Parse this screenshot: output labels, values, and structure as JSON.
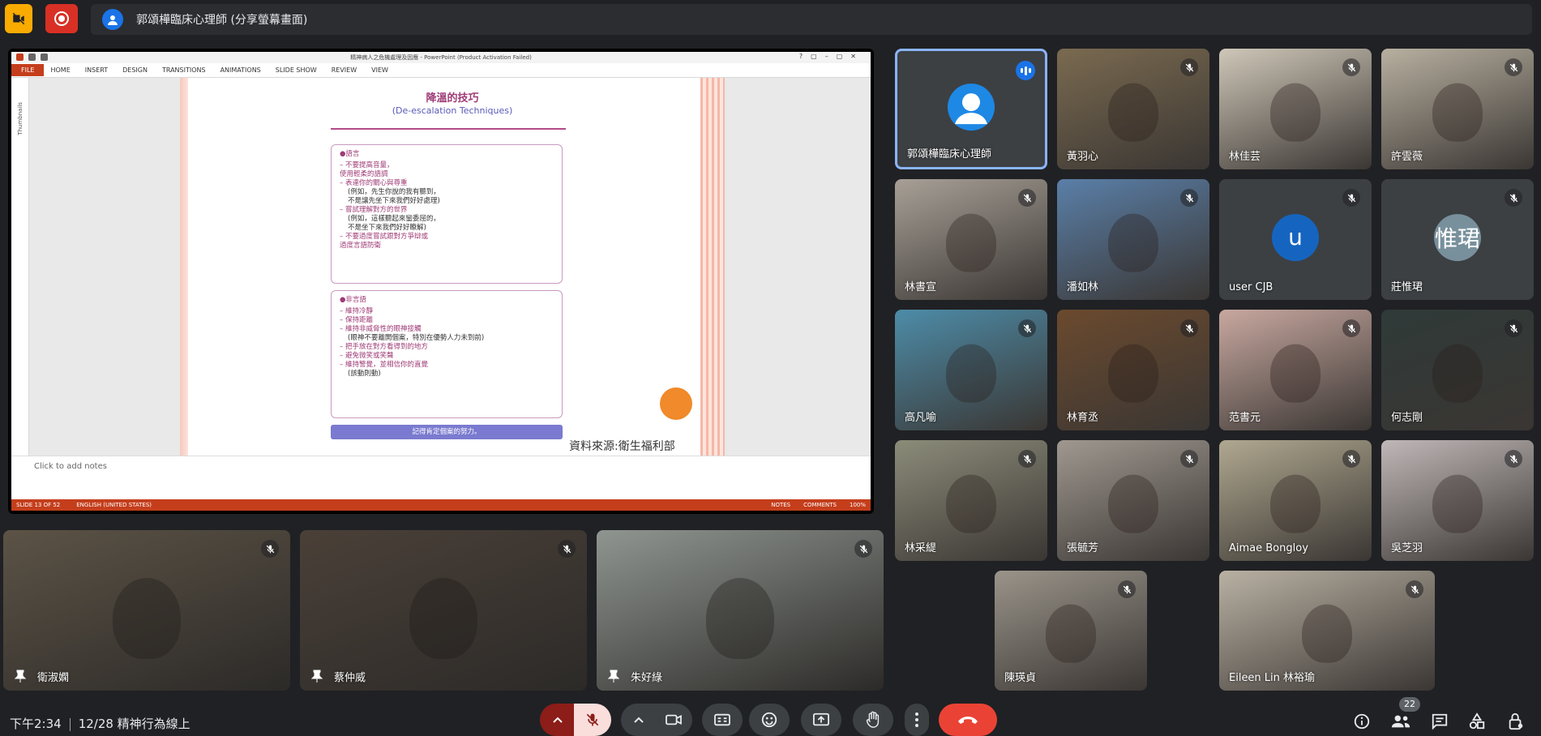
{
  "topbar": {
    "presenter_label": "郭頌樺臨床心理師 (分享螢幕畫面)"
  },
  "ppt": {
    "window_title": "精神病人之危機處理及因應 - PowerPoint (Product Activation Failed)",
    "menu": [
      "FILE",
      "HOME",
      "INSERT",
      "DESIGN",
      "TRANSITIONS",
      "ANIMATIONS",
      "SLIDE SHOW",
      "REVIEW",
      "VIEW"
    ],
    "thumbs_label": "Thumbnails",
    "slide_title": "降溫的技巧",
    "slide_subtitle": "(De-escalation Techniques)",
    "verbal_header": "●語言",
    "verbal_lines": [
      {
        "t": "ln",
        "v": "– 不要提高音量，"
      },
      {
        "t": "ln",
        "v": "   使用輕柔的語調"
      },
      {
        "t": "ln",
        "v": "– 表達你的關心與尊重"
      },
      {
        "t": "nt",
        "v": "(例如，先生你說的我有聽到，"
      },
      {
        "t": "nt",
        "v": "不是讓先坐下來我們好好處理)"
      },
      {
        "t": "ln",
        "v": "– 嘗試理解對方的世界"
      },
      {
        "t": "nt",
        "v": "(例如，這樣聽起來蠻委屈的，"
      },
      {
        "t": "nt",
        "v": "不是坐下來我們好好瞭解)"
      },
      {
        "t": "ln",
        "v": "– 不要過度嘗試跟對方爭辯或"
      },
      {
        "t": "ln",
        "v": "   過度言語防衛"
      }
    ],
    "nonverbal_header": "●非言語",
    "nonverbal_lines": [
      {
        "t": "ln",
        "v": "– 維持冷靜"
      },
      {
        "t": "ln",
        "v": "– 保持距離"
      },
      {
        "t": "ln",
        "v": "– 維持非威脅性的眼神接觸"
      },
      {
        "t": "nt",
        "v": "(眼神不要離開個案，特別在優勢人力未到前)"
      },
      {
        "t": "ln",
        "v": "– 把手放在對方看得到的地方"
      },
      {
        "t": "ln",
        "v": "– 避免微笑或笑聲"
      },
      {
        "t": "ln",
        "v": "– 維持警覺，並相信你的直覺"
      },
      {
        "t": "nt",
        "v": "(該動則動)"
      }
    ],
    "slide_bar": "記得肯定個案的努力。",
    "slide_source": "資料來源:衛生福利部",
    "notes_placeholder": "Click to add notes",
    "status_slide": "SLIDE 13 OF 52",
    "status_lang": "ENGLISH (UNITED STATES)",
    "status_notes": "NOTES",
    "status_comments": "COMMENTS",
    "zoom": "100%"
  },
  "participants_grid": [
    {
      "name": "郭頌樺臨床心理師",
      "type": "avatar",
      "color": "#1e88e5",
      "speaking": true
    },
    {
      "name": "黃羽心",
      "type": "video",
      "bg": "#7a6a50"
    },
    {
      "name": "林佳芸",
      "type": "video",
      "bg": "#cfc7b8"
    },
    {
      "name": "許雲薇",
      "type": "video",
      "bg": "#b8b0a0"
    },
    {
      "name": "林書宣",
      "type": "video",
      "bg": "#a8a097"
    },
    {
      "name": "潘如林",
      "type": "video",
      "bg": "#5a7fa8"
    },
    {
      "name": "user CJB",
      "type": "avatar",
      "letter": "u",
      "color": "#1565c0"
    },
    {
      "name": "莊惟珺",
      "type": "avatar",
      "letter": "惟珺",
      "color": "#78909c"
    },
    {
      "name": "高凡喻",
      "type": "video",
      "bg": "#4d8ca8"
    },
    {
      "name": "林育丞",
      "type": "video",
      "bg": "#6b4a2e"
    },
    {
      "name": "范書元",
      "type": "video",
      "bg": "#c8a8a0"
    },
    {
      "name": "何志剛",
      "type": "video",
      "bg": "#2f3a38"
    },
    {
      "name": "林采緹",
      "type": "video",
      "bg": "#8c8c7a"
    },
    {
      "name": "張毓芳",
      "type": "video",
      "bg": "#a09890"
    },
    {
      "name": "Aimae Bongloy",
      "type": "video",
      "bg": "#b0a890"
    },
    {
      "name": "吳芝羽",
      "type": "video",
      "bg": "#c0b8b8"
    },
    {
      "name": "陳瑛貞",
      "type": "video",
      "bg": "#9a948a"
    },
    {
      "name": "Eileen Lin 林裕瑜",
      "type": "video",
      "bg": "#b9b1a3"
    }
  ],
  "participants_bottom": [
    {
      "name": "衛淑嫻",
      "bg": "#5c5346"
    },
    {
      "name": "蔡仲威",
      "bg": "#4a4038"
    },
    {
      "name": "朱好綠",
      "bg": "#8f9590"
    }
  ],
  "bottombar": {
    "time": "下午2:34",
    "meeting": "12/28 精神行為線上",
    "people_count": "22"
  },
  "colors": {
    "bg": "#202124",
    "tile": "#3c4043",
    "leave": "#ea4335",
    "accent": "#8ab4f8",
    "ppt": "#c43e1c"
  }
}
